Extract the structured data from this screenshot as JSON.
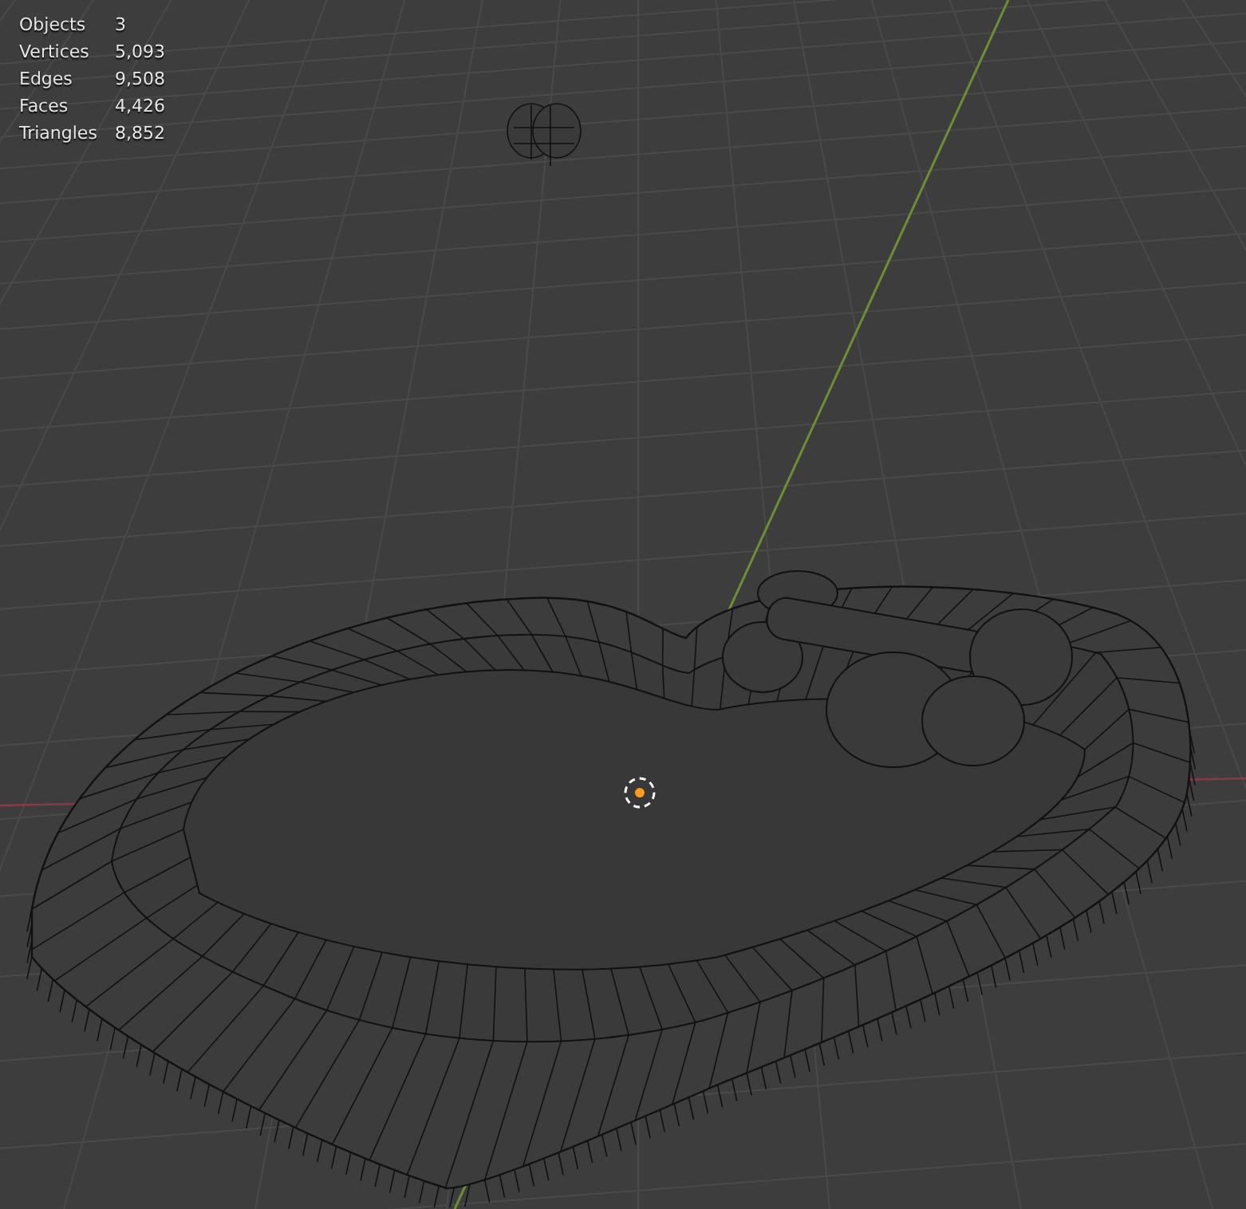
{
  "viewport": {
    "stats": [
      {
        "label": "Objects",
        "value": "3"
      },
      {
        "label": "Vertices",
        "value": "5,093"
      },
      {
        "label": "Edges",
        "value": "9,508"
      },
      {
        "label": "Faces",
        "value": "4,426"
      },
      {
        "label": "Triangles",
        "value": "8,852"
      }
    ]
  }
}
